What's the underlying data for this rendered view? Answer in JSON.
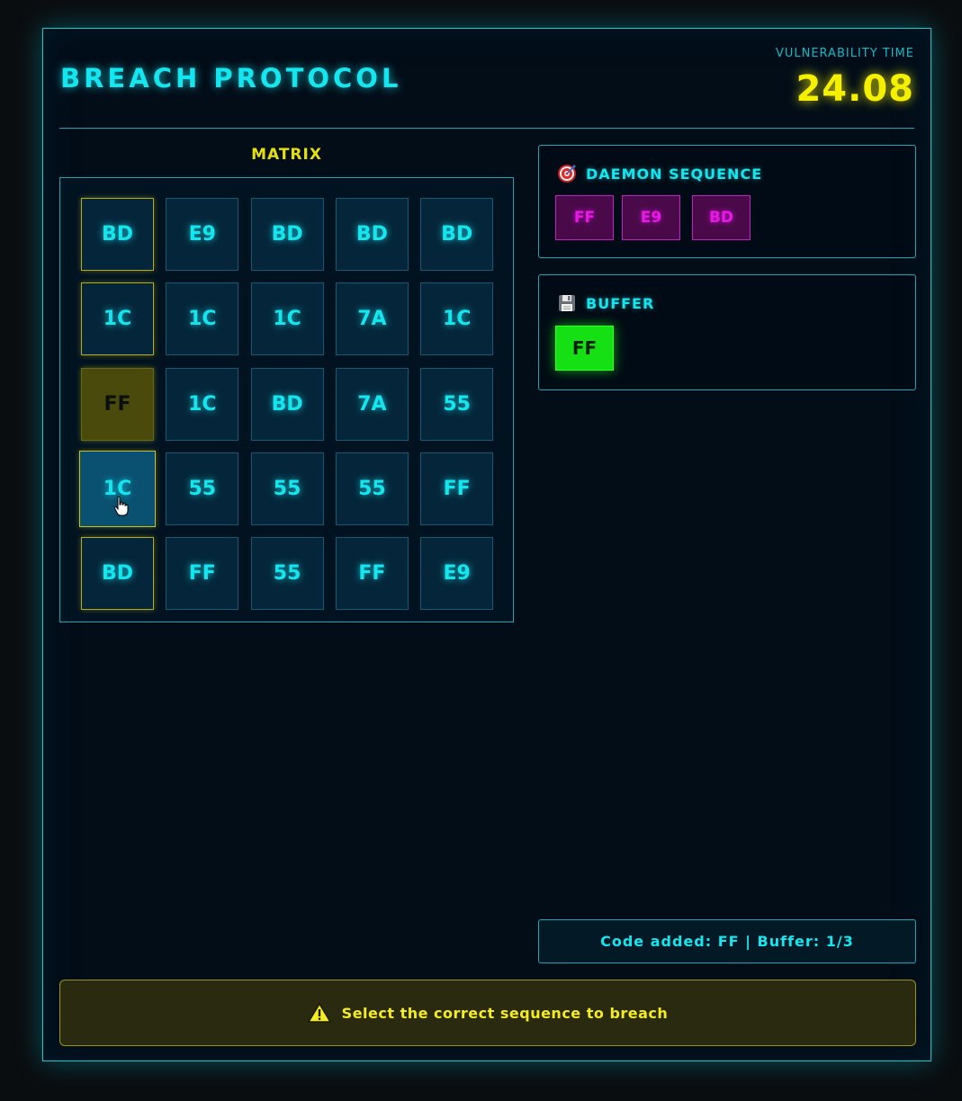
{
  "header": {
    "title": "BREACH PROTOCOL",
    "timer_label": "VULNERABILITY TIME",
    "timer_value": "24.08"
  },
  "matrix": {
    "label": "MATRIX",
    "rows": [
      [
        "BD",
        "E9",
        "BD",
        "BD",
        "BD"
      ],
      [
        "1C",
        "1C",
        "1C",
        "7A",
        "1C"
      ],
      [
        "FF",
        "1C",
        "BD",
        "7A",
        "55"
      ],
      [
        "1C",
        "55",
        "55",
        "55",
        "FF"
      ],
      [
        "BD",
        "FF",
        "55",
        "FF",
        "E9"
      ]
    ],
    "highlighted_column": 0,
    "used_cells": [
      [
        2,
        0
      ]
    ],
    "hovered_cell": [
      3,
      0
    ]
  },
  "daemon": {
    "title": "DAEMON SEQUENCE",
    "icon": "target-icon",
    "sequence": [
      "FF",
      "E9",
      "BD"
    ]
  },
  "buffer": {
    "title": "BUFFER",
    "icon": "floppy-disk-icon",
    "items": [
      "FF"
    ]
  },
  "status": {
    "message": "Code added: FF | Buffer: 1/3"
  },
  "hint": {
    "icon": "warning-icon",
    "text": "Select the correct sequence to breach"
  },
  "colors": {
    "accent": "#14e6f0",
    "timer": "#f4f000",
    "daemon": "#e818e8",
    "buffer": "#14e014"
  }
}
